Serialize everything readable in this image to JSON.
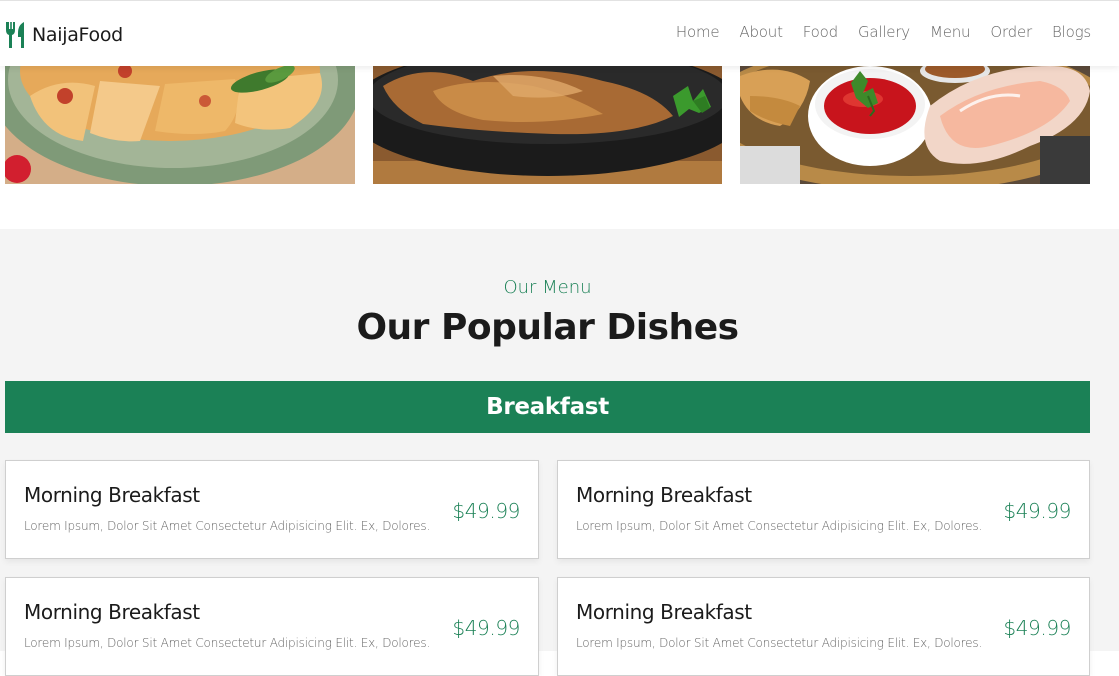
{
  "brand": {
    "name": "NaijaFood",
    "icon": "utensils-icon",
    "accent_color": "#1b8156"
  },
  "nav": {
    "items": [
      "Home",
      "About",
      "Food",
      "Gallery",
      "Menu",
      "Order",
      "Blogs"
    ]
  },
  "gallery": {
    "images": [
      "pizza-photo",
      "roast-chicken-photo",
      "spring-rolls-photo"
    ]
  },
  "menu": {
    "subtitle": "Our Menu",
    "title": "Our Popular Dishes",
    "category": "Breakfast",
    "dishes": [
      {
        "name": "Morning Breakfast",
        "description": "Lorem Ipsum, Dolor Sit Amet Consectetur Adipisicing Elit. Ex, Dolores.",
        "price": "$49.99"
      },
      {
        "name": "Morning Breakfast",
        "description": "Lorem Ipsum, Dolor Sit Amet Consectetur Adipisicing Elit. Ex, Dolores.",
        "price": "$49.99"
      },
      {
        "name": "Morning Breakfast",
        "description": "Lorem Ipsum, Dolor Sit Amet Consectetur Adipisicing Elit. Ex, Dolores.",
        "price": "$49.99"
      },
      {
        "name": "Morning Breakfast",
        "description": "Lorem Ipsum, Dolor Sit Amet Consectetur Adipisicing Elit. Ex, Dolores.",
        "price": "$49.99"
      }
    ]
  }
}
